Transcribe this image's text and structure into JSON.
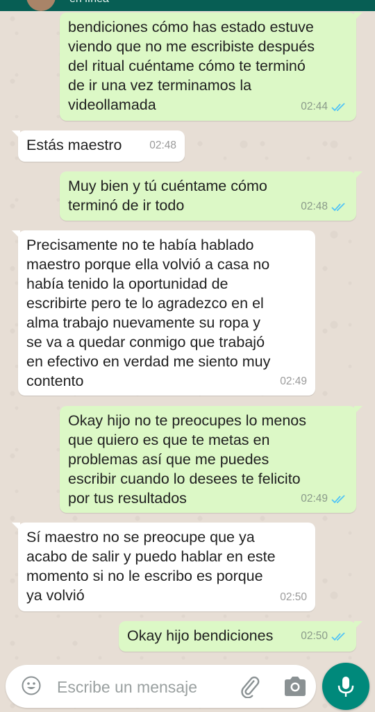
{
  "header": {
    "status": "en línea"
  },
  "messages": [
    {
      "dir": "out",
      "text": "bendiciones cómo has estado estuve\nviendo que no me escribiste después\ndel ritual cuéntame cómo te terminó\nde ir una vez terminamos la\nvideollamada",
      "time": "02:44",
      "read": true
    },
    {
      "dir": "in",
      "text": "Estás maestro",
      "time": "02:48"
    },
    {
      "dir": "out",
      "text": "Muy bien y tú cuéntame cómo\nterminó de ir todo",
      "time": "02:48",
      "read": true
    },
    {
      "dir": "in",
      "text": "Precisamente no te había hablado\nmaestro porque ella volvió a casa no\nhabía tenido la oportunidad de\nescribirte pero te lo agradezco en el\nalma trabajo nuevamente su ropa y\nse va a quedar conmigo que trabajó\nen efectivo en verdad me siento muy\ncontento",
      "time": "02:49"
    },
    {
      "dir": "out",
      "text": "Okay hijo no te preocupes lo menos\nque quiero es que te metas en\nproblemas así que me puedes\nescribir cuando lo desees te felicito\npor tus resultados",
      "time": "02:49",
      "read": true
    },
    {
      "dir": "in",
      "text": "Sí maestro no se preocupe que ya\nacabo de salir y puedo hablar en este\nmomento si no le escribo es porque\nya volvió",
      "time": "02:50"
    },
    {
      "dir": "out",
      "text": "Okay hijo bendiciones",
      "time": "02:50",
      "read": true
    }
  ],
  "composer": {
    "placeholder": "Escribe un mensaje"
  },
  "icons": {
    "emoji": "emoji-icon",
    "attach": "paperclip-icon",
    "camera": "camera-icon",
    "mic": "microphone-icon",
    "read_receipt": "double-check-icon"
  },
  "colors": {
    "outgoing_bubble": "#dcf8c6",
    "incoming_bubble": "#ffffff",
    "read_tick": "#4fc3f7",
    "mic_button": "#00897b",
    "header": "#075e54"
  }
}
